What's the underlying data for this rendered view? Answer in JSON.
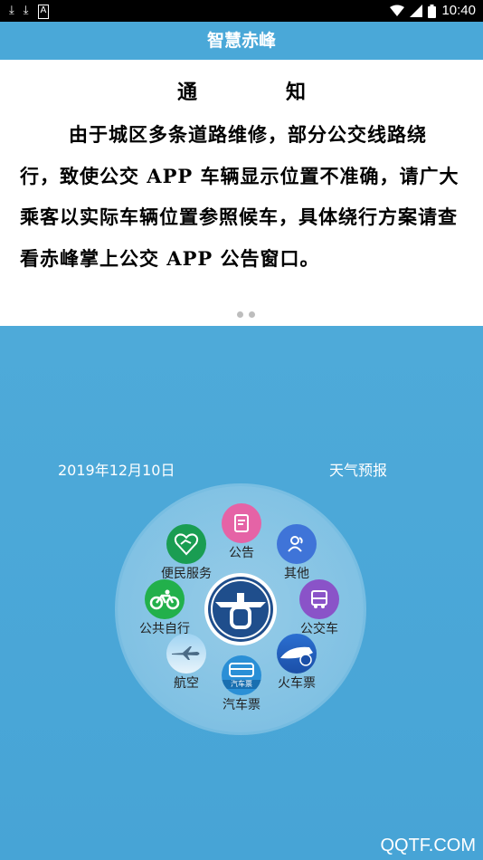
{
  "status_bar": {
    "time": "10:40",
    "left_icons": [
      "download-icon",
      "download-icon",
      "a-icon"
    ],
    "right_icons": [
      "wifi-icon",
      "signal-icon",
      "battery-icon"
    ]
  },
  "header": {
    "title": "智慧赤峰"
  },
  "notice": {
    "title": "通　知",
    "body": "由于城区多条道路维修，部分公交线路绕行，致使公交 APP 车辆显示位置不准确，请广大乘客以实际车辆位置参照候车，具体绕行方案请查看赤峰掌上公交 APP 公告窗口。",
    "page_dots": 2
  },
  "info_row": {
    "date": "2019年12月10日",
    "weather_link": "天气预报"
  },
  "menu": {
    "announcement": "公告",
    "other": "其他",
    "bus": "公交车",
    "train": "火车票",
    "coach": "汽车票",
    "coach_badge": "汽车票",
    "flight": "航空",
    "bike": "公共自行",
    "service": "便民服务"
  },
  "colors": {
    "primary": "#4aa8d8",
    "announcement": "#e563a6",
    "other": "#3f74d8",
    "bus": "#8a53c8",
    "bike": "#22b04b",
    "service": "#1a9d52",
    "logo_blue": "#1f4e8c"
  },
  "watermark": "QQTF.COM"
}
